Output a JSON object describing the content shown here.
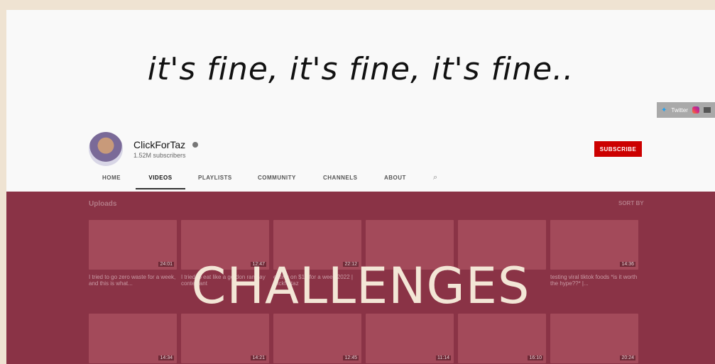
{
  "banner": {
    "text": "it's fine, it's fine, it's fine..",
    "twitter_label": "Twitter"
  },
  "channel": {
    "name": "ClickForTaz",
    "subscribers": "1.52M subscribers",
    "subscribe_label": "SUBSCRIBE"
  },
  "tabs": [
    "HOME",
    "VIDEOS",
    "PLAYLISTS",
    "COMMUNITY",
    "CHANNELS",
    "ABOUT"
  ],
  "section": {
    "uploads": "Uploads",
    "sort_by": "SORT BY"
  },
  "videos_row1": [
    {
      "duration": "24:01",
      "title": "I tried to go zero waste for a week, and this is what..."
    },
    {
      "duration": "12:47",
      "title": "I tried to eat like a gordon ramsay contestant"
    },
    {
      "duration": "22:12",
      "title": "eating on $12 for a week 2022 | clickfortaz"
    },
    {
      "duration": "",
      "title": ""
    },
    {
      "duration": "",
      "title": ""
    },
    {
      "duration": "14:36",
      "title": "testing viral tiktok foods *is it worth the hype??* |..."
    }
  ],
  "videos_row2": [
    {
      "duration": "14:34"
    },
    {
      "duration": "14:21"
    },
    {
      "duration": "12:45"
    },
    {
      "duration": "11:14"
    },
    {
      "duration": "16:10"
    },
    {
      "duration": "20:24"
    }
  ],
  "headline": "CHALLENGES"
}
